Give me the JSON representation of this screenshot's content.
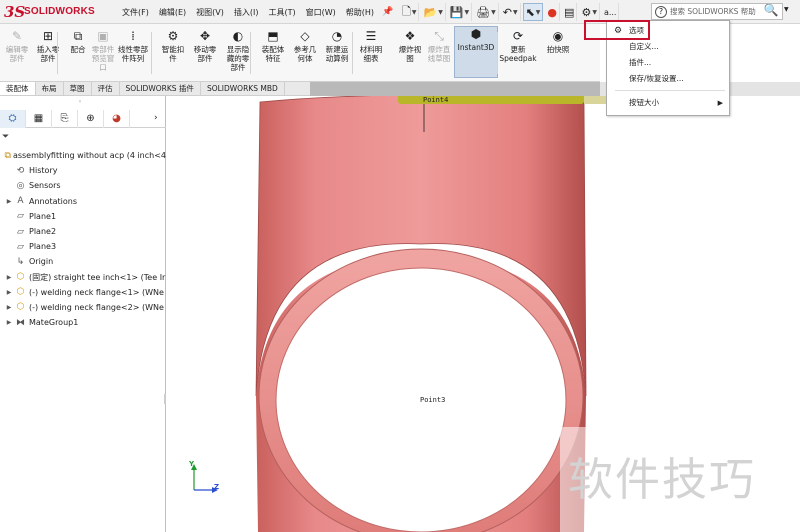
{
  "app": {
    "logo_ds": "3S",
    "logo_text": "SOLIDWORKS",
    "brand_color": "#c8102e"
  },
  "menu": [
    "文件(F)",
    "编辑(E)",
    "视图(V)",
    "插入(I)",
    "工具(T)",
    "窗口(W)",
    "帮助(H)"
  ],
  "quickbar": {
    "user_label": "a...",
    "search_placeholder": "搜索 SOLIDWORKS 帮助"
  },
  "commands": [
    {
      "label": "编辑零\n部件",
      "icon": "edit-component-icon",
      "dim": true
    },
    {
      "label": "插入零\n部件",
      "icon": "insert-component-icon",
      "dim": false
    },
    {
      "label": "配合",
      "icon": "mate-icon",
      "dim": false
    },
    {
      "label": "零部件\n预览窗\n口",
      "icon": "component-preview-icon",
      "dim": true
    },
    {
      "label": "线性零部\n件阵列",
      "icon": "linear-pattern-icon",
      "dim": false
    },
    {
      "label": "智能扣\n件",
      "icon": "smart-fastener-icon",
      "dim": false
    },
    {
      "label": "移动零\n部件",
      "icon": "move-component-icon",
      "dim": false
    },
    {
      "label": "显示隐\n藏的零\n部件",
      "icon": "show-hidden-icon",
      "dim": false
    },
    {
      "label": "装配体\n特征",
      "icon": "assembly-feature-icon",
      "dim": false
    },
    {
      "label": "参考几\n何体",
      "icon": "reference-geometry-icon",
      "dim": false
    },
    {
      "label": "新建运\n动算例",
      "icon": "motion-study-icon",
      "dim": false
    },
    {
      "label": "材料明\n细表",
      "icon": "bom-icon",
      "dim": false
    },
    {
      "label": "爆炸视\n图",
      "icon": "exploded-view-icon",
      "dim": false
    },
    {
      "label": "爆炸直\n线草图",
      "icon": "explode-line-sketch-icon",
      "dim": true
    },
    {
      "label": "Instant3D",
      "icon": "instant3d-icon",
      "dim": false,
      "active": true
    },
    {
      "label": "更新\nSpeedpak",
      "icon": "speedpak-icon",
      "dim": false
    },
    {
      "label": "拍快照",
      "icon": "snapshot-icon",
      "dim": false
    }
  ],
  "tabs": [
    "装配体",
    "布局",
    "草图",
    "评估",
    "SOLIDWORKS 插件",
    "SOLIDWORKS MBD"
  ],
  "tree": [
    {
      "label": "assemblyfitting without acp  (4 inch<4",
      "icon": "assembly-icon",
      "expand": "",
      "indent": 0
    },
    {
      "label": "History",
      "icon": "history-icon",
      "expand": "",
      "indent": 1
    },
    {
      "label": "Sensors",
      "icon": "sensors-icon",
      "expand": "",
      "indent": 1
    },
    {
      "label": "Annotations",
      "icon": "annotations-icon",
      "expand": "▶",
      "indent": 1
    },
    {
      "label": "Plane1",
      "icon": "plane-icon",
      "expand": "",
      "indent": 1
    },
    {
      "label": "Plane2",
      "icon": "plane-icon",
      "expand": "",
      "indent": 1
    },
    {
      "label": "Plane3",
      "icon": "plane-icon",
      "expand": "",
      "indent": 1
    },
    {
      "label": "Origin",
      "icon": "origin-icon",
      "expand": "",
      "indent": 1
    },
    {
      "label": "(固定) straight tee inch<1> (Tee Ir",
      "icon": "part-icon",
      "expand": "▶",
      "indent": 1
    },
    {
      "label": "(-) welding neck flange<1> (WNe",
      "icon": "part-icon",
      "expand": "▶",
      "indent": 1
    },
    {
      "label": "(-) welding neck flange<2> (WNe",
      "icon": "part-icon",
      "expand": "▶",
      "indent": 1
    },
    {
      "label": "MateGroup1",
      "icon": "mategroup-icon",
      "expand": "▶",
      "indent": 1
    }
  ],
  "graphics": {
    "point_top": "Point4",
    "point_mid": "Point3",
    "triad_y": "Y",
    "triad_z": "Z",
    "pipe_color": "#e57f7b",
    "pipe_dark": "#b95350"
  },
  "options_menu": {
    "items": [
      "选项",
      "自定义...",
      "插件...",
      "保存/恢复设置...",
      "按钮大小"
    ]
  },
  "watermark": "软件技巧"
}
